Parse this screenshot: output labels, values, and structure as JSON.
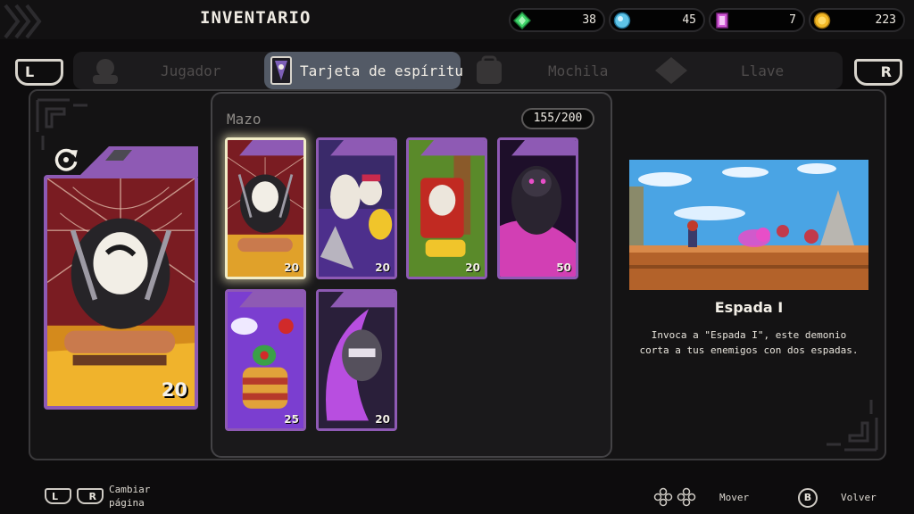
{
  "header": {
    "title": "INVENTARIO",
    "currencies": [
      {
        "icon": "green-gem-icon",
        "value": "38",
        "color": "#3fd46a"
      },
      {
        "icon": "blue-orb-icon",
        "value": "45",
        "color": "#5fc4e8"
      },
      {
        "icon": "pink-crystal-icon",
        "value": "7",
        "color": "#d35bd8"
      },
      {
        "icon": "gold-coin-icon",
        "value": "223",
        "color": "#f2b826"
      }
    ]
  },
  "tabs": {
    "left_shoulder": "L",
    "right_shoulder": "R",
    "items": [
      "Jugador",
      "Tarjeta de espíritu",
      "Mochila",
      "Llave"
    ],
    "active": "Tarjeta de espíritu"
  },
  "deck": {
    "title": "Mazo",
    "count": "155/200",
    "cards": [
      {
        "name": "Espada I",
        "cost": "20",
        "selected": true
      },
      {
        "cost": "20"
      },
      {
        "cost": "20"
      },
      {
        "cost": "50"
      },
      {
        "cost": "25"
      },
      {
        "cost": "20"
      }
    ]
  },
  "selected_card": {
    "cost": "20",
    "name": "Espada I",
    "description": "Invoca a \"Espada I\", este demonio corta a tus enemigos con dos espadas."
  },
  "footer": {
    "l_button": "L",
    "r_button": "R",
    "change_page": "Cambiar página",
    "move": "Mover",
    "b_button": "B",
    "back": "Volver"
  },
  "colors": {
    "card_border": "#8e5ab4",
    "selected_glow": "#f1ecc6",
    "active_tab": "#535a66"
  }
}
